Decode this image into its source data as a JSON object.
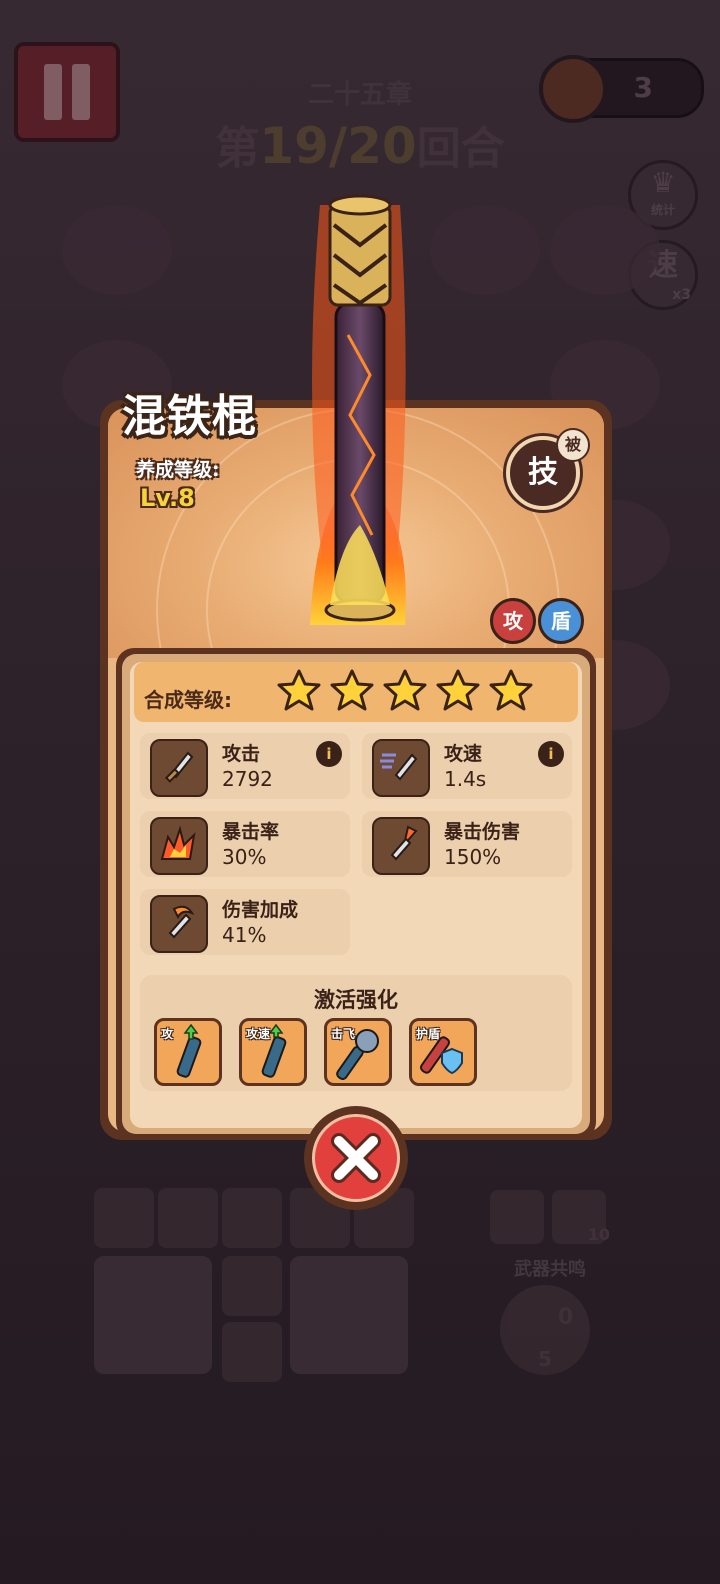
{
  "hud": {
    "chapter": "二十五章",
    "round_prefix": "第",
    "round_value": "19/20",
    "round_suffix": "回合",
    "currency": "3",
    "stats_label": "统计",
    "speed_label": "速",
    "speed_multiplier": "x3"
  },
  "weapon": {
    "name": "混铁棍",
    "level_label": "养成等级:",
    "level": "Lv.8",
    "skill_label": "技",
    "skill_badge": "被",
    "tags": [
      "攻",
      "盾"
    ]
  },
  "merge": {
    "label": "合成等级:",
    "stars": 5
  },
  "stats": [
    {
      "name": "攻击",
      "value": "2792",
      "icon": "sword-icon",
      "info": true
    },
    {
      "name": "攻速",
      "value": "1.4s",
      "icon": "speed-sword-icon",
      "info": true
    },
    {
      "name": "暴击率",
      "value": "30%",
      "icon": "crit-burst-icon",
      "info": false
    },
    {
      "name": "暴击伤害",
      "value": "150%",
      "icon": "crit-damage-icon",
      "info": false
    },
    {
      "name": "伤害加成",
      "value": "41%",
      "icon": "damage-bonus-icon",
      "info": false
    }
  ],
  "enhancements": {
    "title": "激活强化",
    "items": [
      {
        "label": "攻",
        "icon": "staff-attack-up-icon"
      },
      {
        "label": "攻速",
        "icon": "staff-speed-up-icon"
      },
      {
        "label": "击飞",
        "icon": "mace-knockback-icon"
      },
      {
        "label": "护盾",
        "icon": "fire-staff-shield-icon"
      }
    ]
  },
  "background": {
    "resonance_label": "武器共鸣",
    "counts": [
      "10",
      "0",
      "5"
    ]
  },
  "colors": {
    "accent_gold": "#f7d23a",
    "close_red": "#e2403c",
    "card_brown": "#5b3320",
    "panel_tan": "#f3d8b7"
  }
}
